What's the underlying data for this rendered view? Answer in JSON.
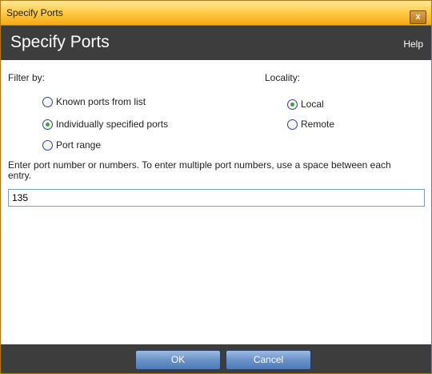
{
  "window": {
    "title": "Specify Ports",
    "close_label": "x"
  },
  "header": {
    "heading": "Specify Ports",
    "help": "Help"
  },
  "filter": {
    "label": "Filter by:",
    "options": [
      {
        "label": "Known ports from list",
        "checked": false
      },
      {
        "label": "Individually specified ports",
        "checked": true
      },
      {
        "label": "Port range",
        "checked": false
      }
    ]
  },
  "locality": {
    "label": "Locality:",
    "options": [
      {
        "label": "Local",
        "checked": true
      },
      {
        "label": "Remote",
        "checked": false
      }
    ]
  },
  "entry": {
    "instructions": "Enter port number or numbers. To enter multiple port numbers, use a space between each entry.",
    "value": "135"
  },
  "footer": {
    "ok_label": "OK",
    "cancel_label": "Cancel"
  }
}
